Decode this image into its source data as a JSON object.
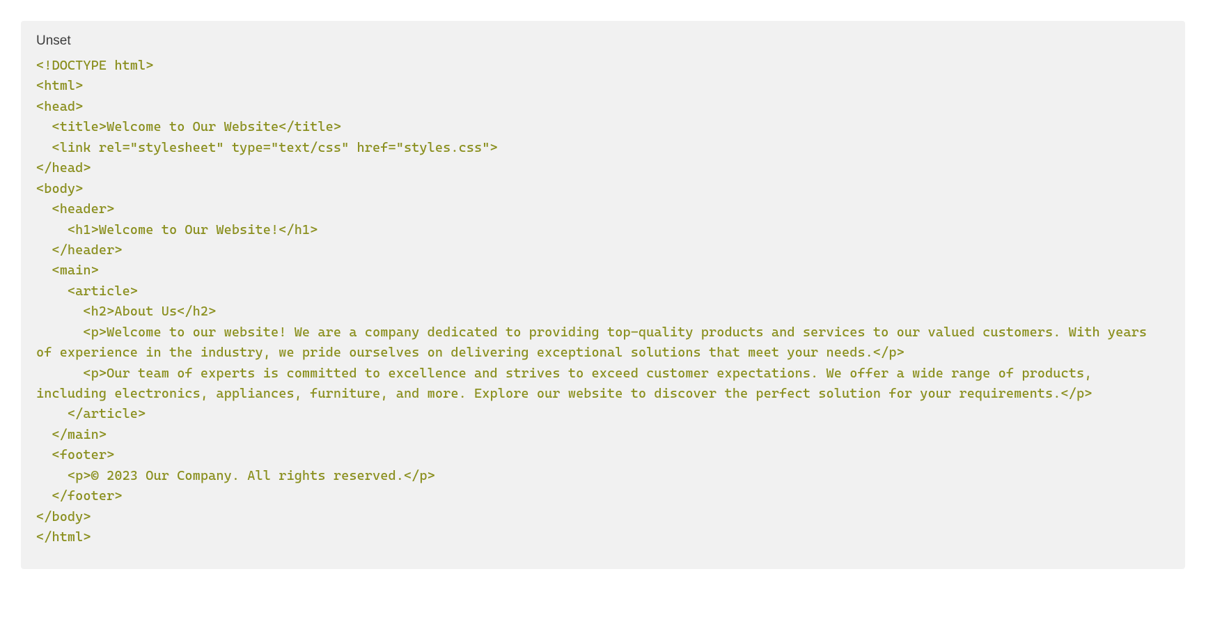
{
  "lang_label": "Unset",
  "code": "<!DOCTYPE html>\n<html>\n<head>\n  <title>Welcome to Our Website</title>\n  <link rel=\"stylesheet\" type=\"text/css\" href=\"styles.css\">\n</head>\n<body>\n  <header>\n    <h1>Welcome to Our Website!</h1>\n  </header>\n  <main>\n    <article>\n      <h2>About Us</h2>\n      <p>Welcome to our website! We are a company dedicated to providing top-quality products and services to our valued customers. With years of experience in the industry, we pride ourselves on delivering exceptional solutions that meet your needs.</p>\n      <p>Our team of experts is committed to excellence and strives to exceed customer expectations. We offer a wide range of products, including electronics, appliances, furniture, and more. Explore our website to discover the perfect solution for your requirements.</p>\n    </article>\n  </main>\n  <footer>\n    <p>© 2023 Our Company. All rights reserved.</p>\n  </footer>\n</body>\n</html>"
}
